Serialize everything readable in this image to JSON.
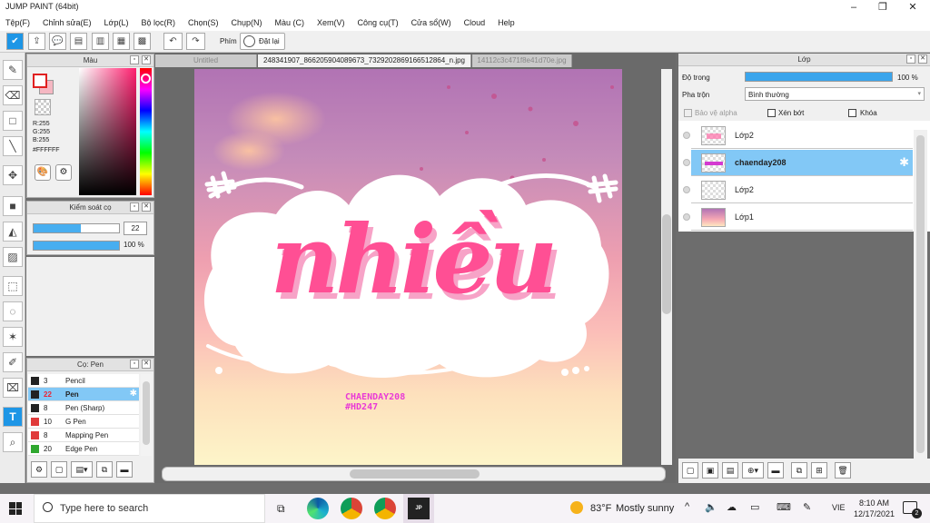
{
  "window": {
    "title": "JUMP PAINT (64bit)",
    "min": "–",
    "max": "❐",
    "close": "✕"
  },
  "menu": [
    "Tệp(F)",
    "Chỉnh sửa(E)",
    "Lớp(L)",
    "Bộ lọc(R)",
    "Chọn(S)",
    "Chụp(N)",
    "Màu (C)",
    "Xem(V)",
    "Công cụ(T)",
    "Cửa sổ(W)",
    "Cloud",
    "Help"
  ],
  "toolbar": {
    "phim_label": "Phím",
    "reset_label": "Đặt lại"
  },
  "color_panel": {
    "title": "Màu",
    "r": "R:255",
    "g": "G:255",
    "b": "B:255",
    "hex": "#FFFFFF"
  },
  "brush_control": {
    "title": "Kiểm soát cọ",
    "size": "22",
    "opacity": "100 %",
    "size_fraction": 0.55,
    "opacity_fraction": 1.0
  },
  "brush_list": {
    "title": "Cọ: Pen",
    "items": [
      {
        "size": "3",
        "name": "Pencil",
        "color": "#222222"
      },
      {
        "size": "22",
        "name": "Pen",
        "color": "#222222"
      },
      {
        "size": "8",
        "name": "Pen (Sharp)",
        "color": "#222222"
      },
      {
        "size": "10",
        "name": "G Pen",
        "color": "#e03a3a"
      },
      {
        "size": "8",
        "name": "Mapping Pen",
        "color": "#e03a3a"
      },
      {
        "size": "20",
        "name": "Edge Pen",
        "color": "#2fa82f"
      }
    ]
  },
  "tabs": [
    {
      "label": "Untitled"
    },
    {
      "label": "248341907_866205904089673_7329202869166512864_n.jpg"
    },
    {
      "label": "14112c3c471f8e41d70e.jpg"
    }
  ],
  "artwork": {
    "title_text": "nhiều",
    "credit_line1": "CHAENDAY208",
    "credit_line2": "#HD247"
  },
  "layer_panel": {
    "title": "Lớp",
    "opacity_label": "Độ trong",
    "opacity_value": "100 %",
    "opacity_fraction": 1.0,
    "blend_label": "Pha trộn",
    "blend_value": "Bình thường",
    "protect_alpha": "Bảo vệ alpha",
    "clip": "Xén bớt",
    "lock": "Khóa",
    "layers": [
      {
        "name": "Lớp2",
        "selected": false
      },
      {
        "name": "chaenday208",
        "selected": true
      },
      {
        "name": "Lớp2",
        "selected": false
      },
      {
        "name": "Lớp1",
        "selected": false
      }
    ]
  },
  "taskbar": {
    "search_placeholder": "Type here to search",
    "temp": "83°F",
    "weather": "Mostly sunny",
    "lang": "VIE",
    "time": "8:10 AM",
    "date": "12/17/2021",
    "notif_count": "2"
  }
}
